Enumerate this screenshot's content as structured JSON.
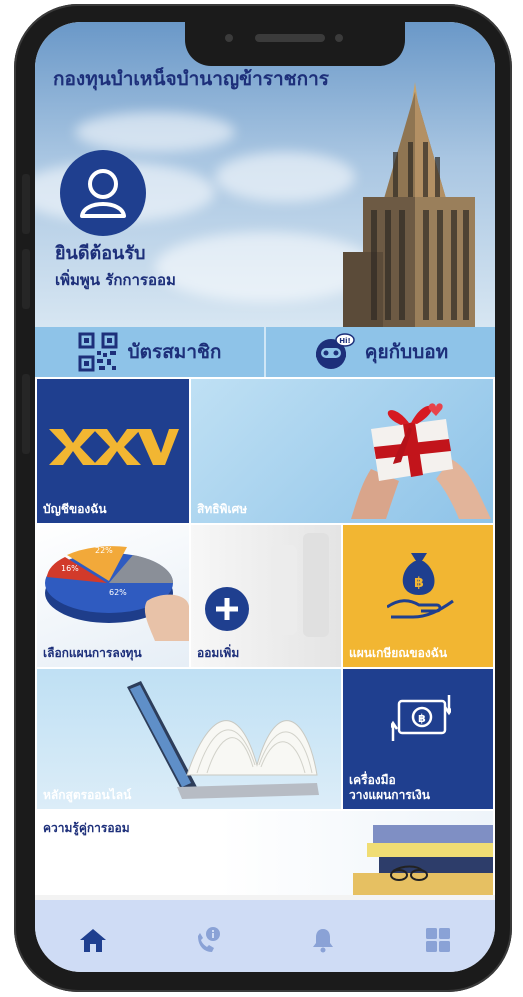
{
  "header": {
    "title": "กองทุนบำเหน็จบำนาญข้าราชการ",
    "welcome": "ยินดีต้อนรับ",
    "tagline": "เพิ่มพูน รักการออม"
  },
  "quick_actions": [
    {
      "label": "บัตรสมาชิก",
      "icon": "qr-code-icon"
    },
    {
      "label": "คุยกับบอท",
      "icon": "robot-icon"
    }
  ],
  "tiles": {
    "my_account": {
      "label": "บัญชีของฉัน",
      "logo": "XXV"
    },
    "privileges": {
      "label": "สิทธิพิเศษ"
    },
    "invest_plan": {
      "label": "เลือกแผนการลงทุน",
      "pie_labels": [
        "22%",
        "16%",
        "62%"
      ]
    },
    "save_more": {
      "label": "ออมเพิ่ม"
    },
    "retirement_plan": {
      "label": "แผนเกษียณของฉัน"
    },
    "online_courses": {
      "label": "หลักสูตรออนไลน์"
    },
    "finance_tools": {
      "label_line1": "เครื่องมือ",
      "label_line2": "วางแผนการเงิน"
    },
    "savings_knowledge": {
      "label": "ความรู้คู่การออม"
    }
  },
  "tabbar": [
    "home-icon",
    "phone-info-icon",
    "bell-icon",
    "grid-icon"
  ],
  "colors": {
    "navy": "#1d2f7a",
    "brand_blue": "#1f3f8f",
    "gold": "#f2b632",
    "light_blue": "#8ec3e8",
    "tabbar_bg": "#cfdcf5"
  }
}
